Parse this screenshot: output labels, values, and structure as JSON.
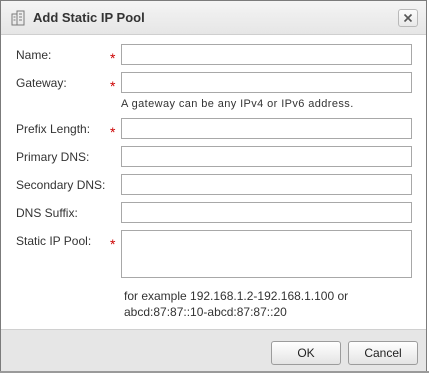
{
  "dialog": {
    "title": "Add Static IP Pool",
    "title_icon": "ip-pool-icon",
    "close_icon": "close-icon"
  },
  "form": {
    "name": {
      "label": "Name:",
      "value": "",
      "required": true
    },
    "gateway": {
      "label": "Gateway:",
      "value": "",
      "required": true,
      "hint": "A gateway can be any IPv4 or IPv6 address."
    },
    "prefix_length": {
      "label": "Prefix Length:",
      "value": "",
      "required": true
    },
    "primary_dns": {
      "label": "Primary DNS:",
      "value": "",
      "required": false
    },
    "secondary_dns": {
      "label": "Secondary DNS:",
      "value": "",
      "required": false
    },
    "dns_suffix": {
      "label": "DNS Suffix:",
      "value": "",
      "required": false
    },
    "static_ip_pool": {
      "label": "Static IP Pool:",
      "value": "",
      "required": true,
      "example_line1": "for example 192.168.1.2-192.168.1.100 or",
      "example_line2": "abcd:87:87::10-abcd:87:87::20"
    },
    "required_marker": "*"
  },
  "footer": {
    "ok_label": "OK",
    "cancel_label": "Cancel"
  }
}
